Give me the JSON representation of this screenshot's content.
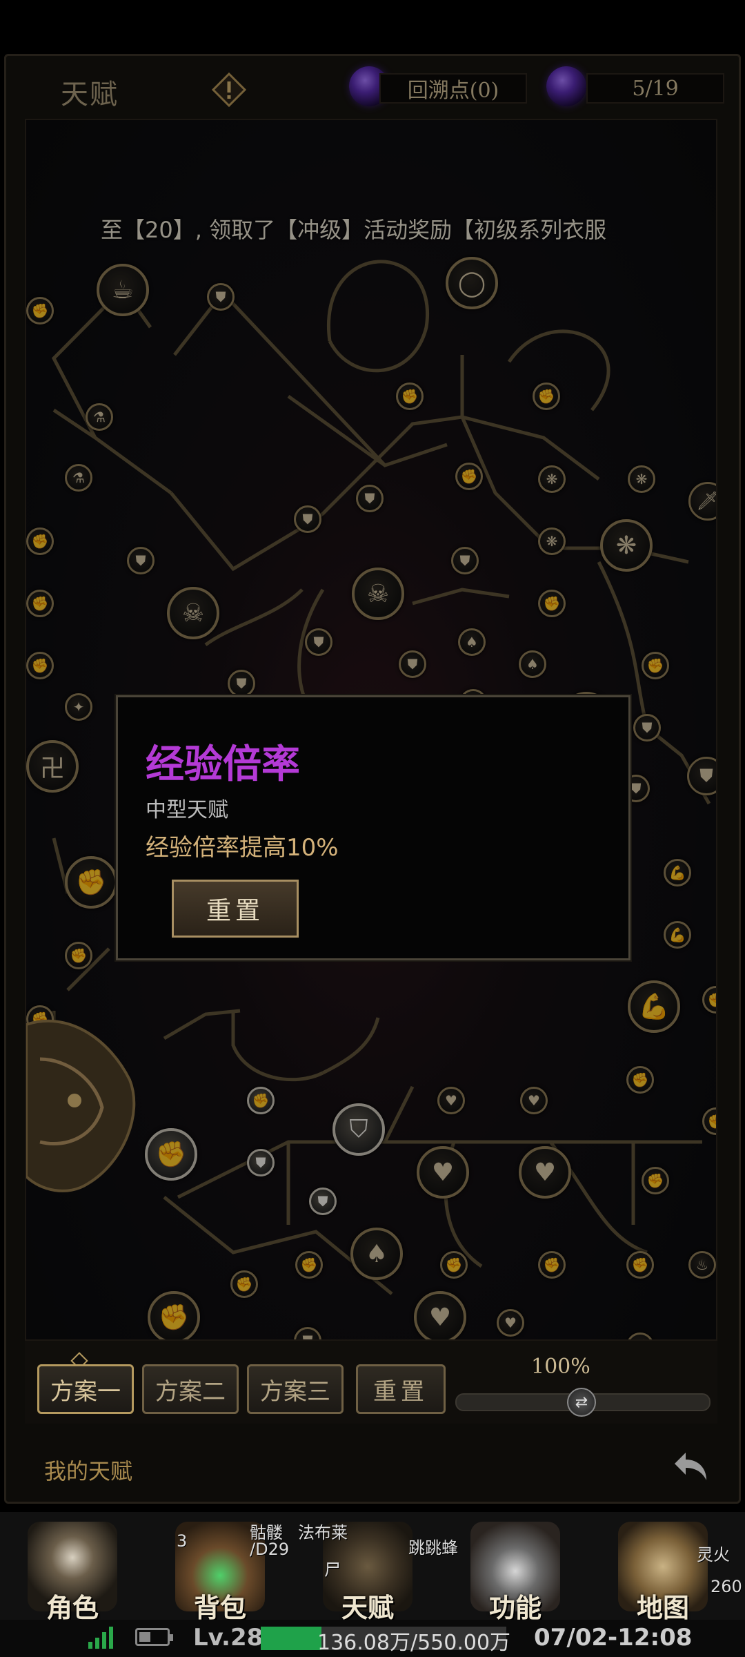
{
  "header": {
    "title": "天赋",
    "backtrack_points": "回溯点(0)",
    "progress": "5/19"
  },
  "banner": "至【20】, 领取了【冲级】活动奖励【初级系列衣服",
  "popup": {
    "title": "经验倍率",
    "subtitle": "中型天赋",
    "description": "经验倍率提高10%",
    "button": "重置",
    "title_color": "#b43ad6"
  },
  "plans": {
    "items": [
      {
        "label": "方案一",
        "active": true
      },
      {
        "label": "方案二",
        "active": false
      },
      {
        "label": "方案三",
        "active": false
      }
    ],
    "reset": "重置",
    "zoom": "100%"
  },
  "footer": {
    "my_talent": "我的天赋"
  },
  "bottom_nav": {
    "items": [
      {
        "label": "角色",
        "icon": "hooded-figure-icon"
      },
      {
        "label": "背包",
        "icon": "backpack-icon"
      },
      {
        "label": "天赋",
        "icon": "dragon-talent-icon"
      },
      {
        "label": "功能",
        "icon": "anvil-icon"
      },
      {
        "label": "地图",
        "icon": "map-icon"
      }
    ],
    "overlay": {
      "badge": "3",
      "t1": "骷髅",
      "t2": "法布莱",
      "t3": "/D29",
      "t4": "尸",
      "t5": "跳跳蜂",
      "t6": "灵火",
      "t7": "260"
    }
  },
  "status_bar": {
    "level": "Lv.28",
    "exp": "136.08万/550.00万",
    "exp_fraction": 0.247,
    "datetime": "07/02-12:08"
  }
}
